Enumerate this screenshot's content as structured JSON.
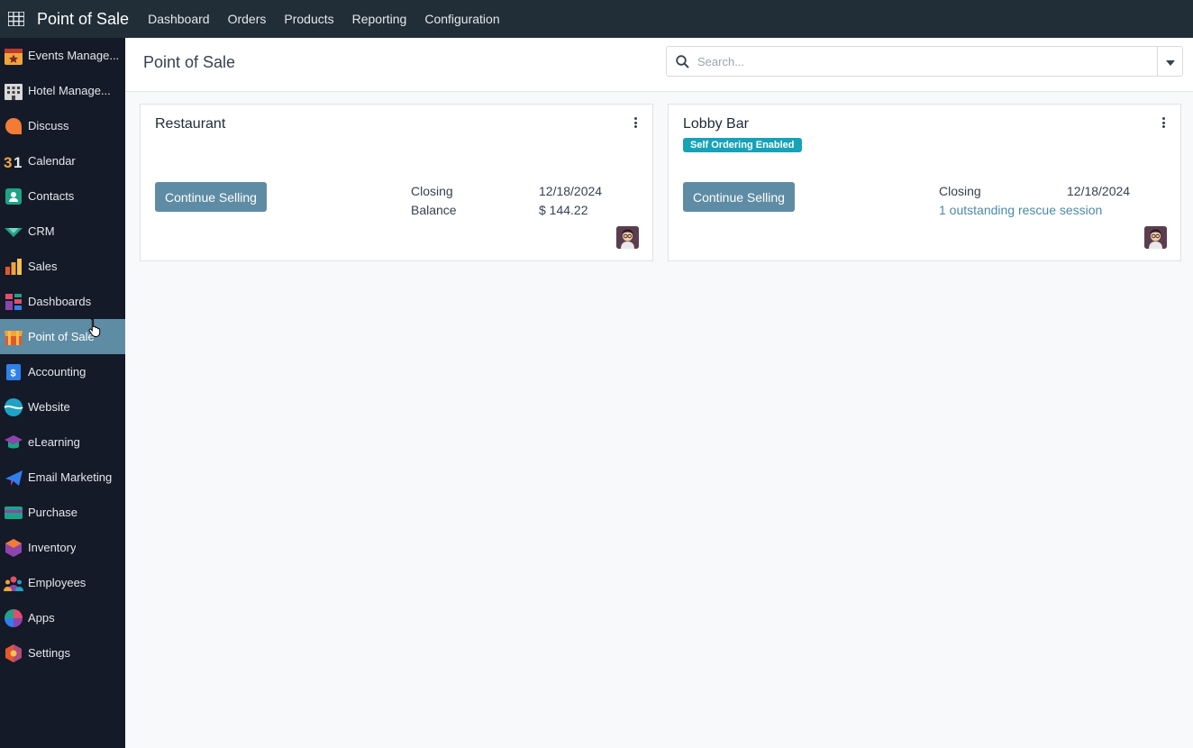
{
  "navbar": {
    "app_title": "Point of Sale",
    "menu": [
      "Dashboard",
      "Orders",
      "Products",
      "Reporting",
      "Configuration"
    ]
  },
  "sidebar": {
    "items": [
      {
        "label": "Events Manage...",
        "icon": "events-icon"
      },
      {
        "label": "Hotel Manage...",
        "icon": "hotel-icon"
      },
      {
        "label": "Discuss",
        "icon": "discuss-icon"
      },
      {
        "label": "Calendar",
        "icon": "calendar-icon"
      },
      {
        "label": "Contacts",
        "icon": "contacts-icon"
      },
      {
        "label": "CRM",
        "icon": "crm-icon"
      },
      {
        "label": "Sales",
        "icon": "sales-icon"
      },
      {
        "label": "Dashboards",
        "icon": "dashboards-icon"
      },
      {
        "label": "Point of Sale",
        "icon": "pos-icon",
        "active": true
      },
      {
        "label": "Accounting",
        "icon": "accounting-icon"
      },
      {
        "label": "Website",
        "icon": "website-icon"
      },
      {
        "label": "eLearning",
        "icon": "elearning-icon"
      },
      {
        "label": "Email Marketing",
        "icon": "email-marketing-icon"
      },
      {
        "label": "Purchase",
        "icon": "purchase-icon"
      },
      {
        "label": "Inventory",
        "icon": "inventory-icon"
      },
      {
        "label": "Employees",
        "icon": "employees-icon"
      },
      {
        "label": "Apps",
        "icon": "apps-icon"
      },
      {
        "label": "Settings",
        "icon": "settings-icon"
      }
    ]
  },
  "control_panel": {
    "breadcrumb": "Point of Sale",
    "search_placeholder": "Search..."
  },
  "cards": {
    "restaurant": {
      "title": "Restaurant",
      "button": "Continue Selling",
      "closing_label": "Closing",
      "closing_date": "12/18/2024",
      "balance_label": "Balance",
      "balance_value": "$ 144.22"
    },
    "lobby_bar": {
      "title": "Lobby Bar",
      "badge": "Self Ordering Enabled",
      "button": "Continue Selling",
      "closing_label": "Closing",
      "closing_date": "12/18/2024",
      "rescue_link": "1 outstanding rescue session"
    }
  },
  "colors": {
    "navbar": "#212e38",
    "sidebar": "#141a28",
    "active_item": "#5e8ca4",
    "primary_button": "#5e8ca4",
    "badge": "#17a2b8",
    "link": "#4b8aa8"
  }
}
